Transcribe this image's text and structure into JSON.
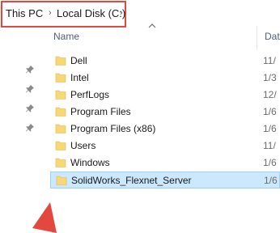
{
  "breadcrumb": {
    "items": [
      {
        "label": "This PC"
      },
      {
        "label": "Local Disk (C:)"
      }
    ],
    "separator": "›"
  },
  "columns": {
    "name": "Name",
    "date": "Dat"
  },
  "files": [
    {
      "name": "Dell",
      "date": "11/",
      "selected": false
    },
    {
      "name": "Intel",
      "date": "1/3",
      "selected": false
    },
    {
      "name": "PerfLogs",
      "date": "12/",
      "selected": false
    },
    {
      "name": "Program Files",
      "date": "1/6",
      "selected": false
    },
    {
      "name": "Program Files (x86)",
      "date": "1/6",
      "selected": false
    },
    {
      "name": "Users",
      "date": "11/",
      "selected": false
    },
    {
      "name": "Windows",
      "date": "1/6",
      "selected": false
    },
    {
      "name": "SolidWorks_Flexnet_Server",
      "date": "1/6",
      "selected": true
    }
  ],
  "quick_access_pins": [
    "pin-icon",
    "pin-icon",
    "pin-icon",
    "pin-icon"
  ],
  "colors": {
    "highlight": "#e3483f",
    "folder": "#f8d775",
    "selection": "#cce8ff"
  }
}
